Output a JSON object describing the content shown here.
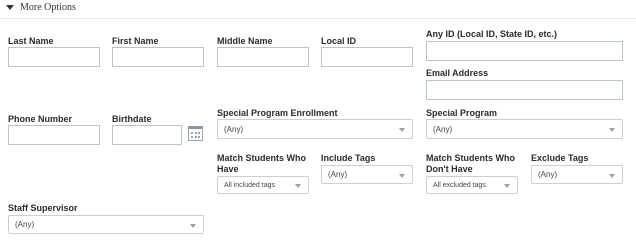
{
  "toggle": {
    "label": "More Options"
  },
  "fields": {
    "last_name": {
      "label": "Last Name",
      "value": ""
    },
    "first_name": {
      "label": "First Name",
      "value": ""
    },
    "middle_name": {
      "label": "Middle Name",
      "value": ""
    },
    "local_id": {
      "label": "Local ID",
      "value": ""
    },
    "any_id": {
      "label": "Any ID (Local ID, State ID, etc.)",
      "value": ""
    },
    "email": {
      "label": "Email Address",
      "value": ""
    },
    "phone": {
      "label": "Phone Number",
      "value": ""
    },
    "birthdate": {
      "label": "Birthdate",
      "value": ""
    }
  },
  "selects": {
    "special_program_enrollment": {
      "label": "Special Program Enrollment",
      "value": "(Any)"
    },
    "special_program": {
      "label": "Special Program",
      "value": "(Any)"
    },
    "match_have": {
      "label_line1": "Match Students Who",
      "label_line2": "Have",
      "value": "All included tags"
    },
    "include_tags": {
      "label": "Include Tags",
      "value": "(Any)"
    },
    "match_dont_have": {
      "label_line1": "Match Students Who",
      "label_line2": "Don't Have",
      "value": "All excluded tags"
    },
    "exclude_tags": {
      "label": "Exclude Tags",
      "value": "(Any)"
    },
    "staff_supervisor": {
      "label": "Staff Supervisor",
      "value": "(Any)"
    }
  }
}
